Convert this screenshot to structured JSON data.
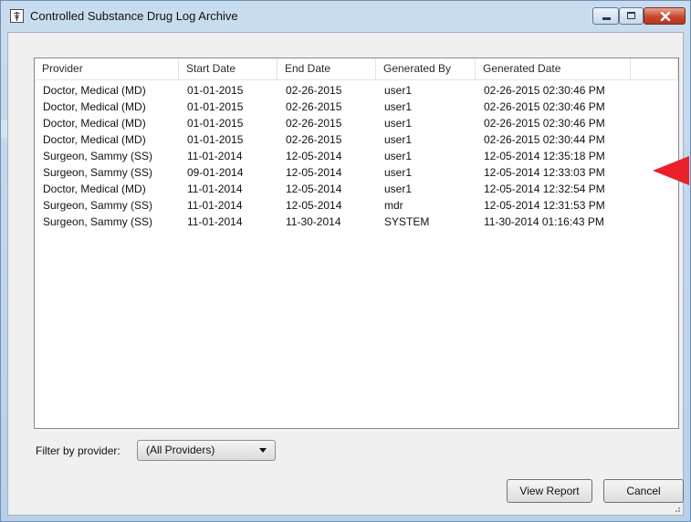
{
  "window": {
    "title": "Controlled Substance Drug Log Archive"
  },
  "table": {
    "columns": [
      "Provider",
      "Start Date",
      "End Date",
      "Generated By",
      "Generated Date",
      ""
    ],
    "rows": [
      [
        "Doctor, Medical  (MD)",
        "01-01-2015",
        "02-26-2015",
        "user1",
        "02-26-2015 02:30:46 PM"
      ],
      [
        "Doctor, Medical  (MD)",
        "01-01-2015",
        "02-26-2015",
        "user1",
        "02-26-2015 02:30:46 PM"
      ],
      [
        "Doctor, Medical  (MD)",
        "01-01-2015",
        "02-26-2015",
        "user1",
        "02-26-2015 02:30:46 PM"
      ],
      [
        "Doctor, Medical  (MD)",
        "01-01-2015",
        "02-26-2015",
        "user1",
        "02-26-2015 02:30:44 PM"
      ],
      [
        "Surgeon, Sammy (SS)",
        "11-01-2014",
        "12-05-2014",
        "user1",
        "12-05-2014 12:35:18 PM"
      ],
      [
        "Surgeon, Sammy (SS)",
        "09-01-2014",
        "12-05-2014",
        "user1",
        "12-05-2014 12:33:03 PM"
      ],
      [
        "Doctor, Medical  (MD)",
        "11-01-2014",
        "12-05-2014",
        "user1",
        "12-05-2014 12:32:54 PM"
      ],
      [
        "Surgeon, Sammy (SS)",
        "11-01-2014",
        "12-05-2014",
        "mdr",
        "12-05-2014 12:31:53 PM"
      ],
      [
        "Surgeon, Sammy (SS)",
        "11-01-2014",
        "11-30-2014",
        "SYSTEM",
        "11-30-2014 01:16:43 PM"
      ]
    ]
  },
  "filter": {
    "label": "Filter by provider:",
    "selected": "(All Providers)"
  },
  "buttons": {
    "view_report": "View Report",
    "cancel": "Cancel"
  },
  "colors": {
    "pointer_arrow": "#e8202a",
    "window_frame": "#b9d0e8"
  },
  "icons": {
    "app": "caduceus-document-icon",
    "minimize": "minimize-icon",
    "maximize": "maximize-icon",
    "close": "close-icon",
    "dropdown": "chevron-down-icon",
    "annotation": "red-pointer-arrow-icon"
  }
}
